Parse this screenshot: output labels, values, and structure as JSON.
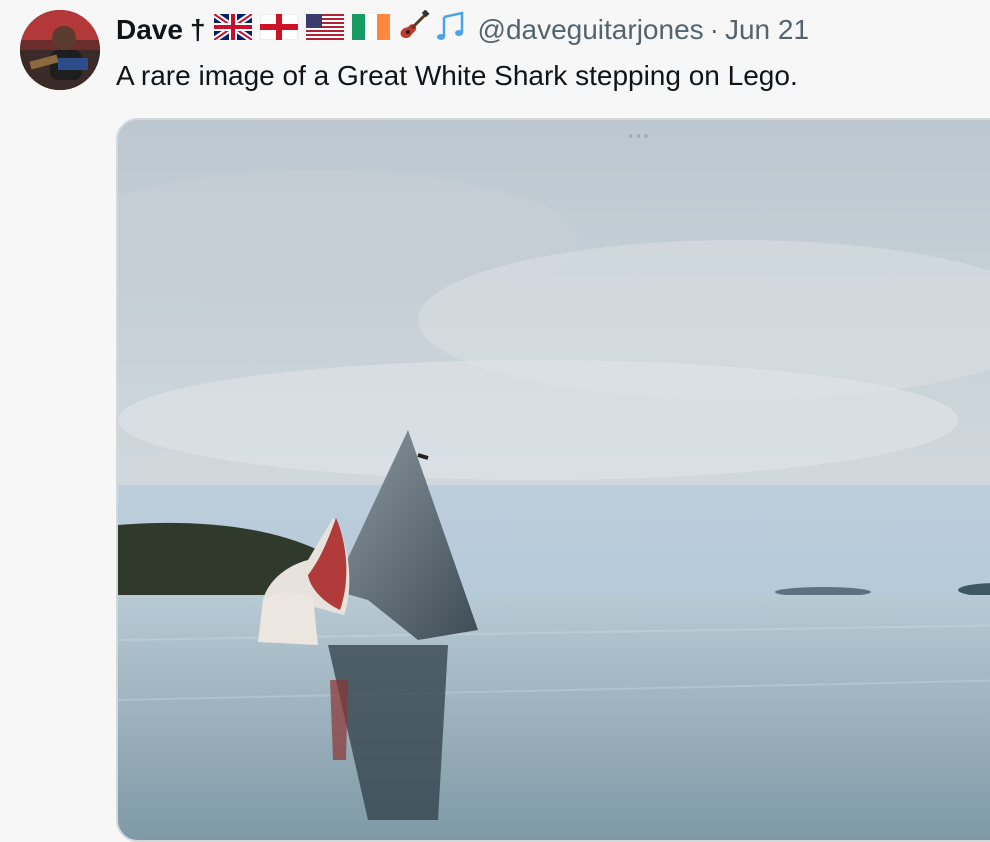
{
  "author": {
    "display_name": "Dave",
    "dagger": "†",
    "emoji_flags": [
      "uk-flag-icon",
      "england-flag-icon",
      "us-flag-icon",
      "ireland-flag-icon"
    ],
    "emoji_extra": [
      "guitar-icon",
      "music-notes-icon"
    ],
    "handle": "@daveguitarjones",
    "separator": "·",
    "date": "Jun 21"
  },
  "tweet": {
    "text": "A rare image of a Great White Shark stepping on Lego."
  },
  "media": {
    "more_label": "···",
    "description_icon": "shark-photo"
  },
  "colors": {
    "text": "#0f1419",
    "secondary": "#536471",
    "background": "#f7f7f7"
  }
}
